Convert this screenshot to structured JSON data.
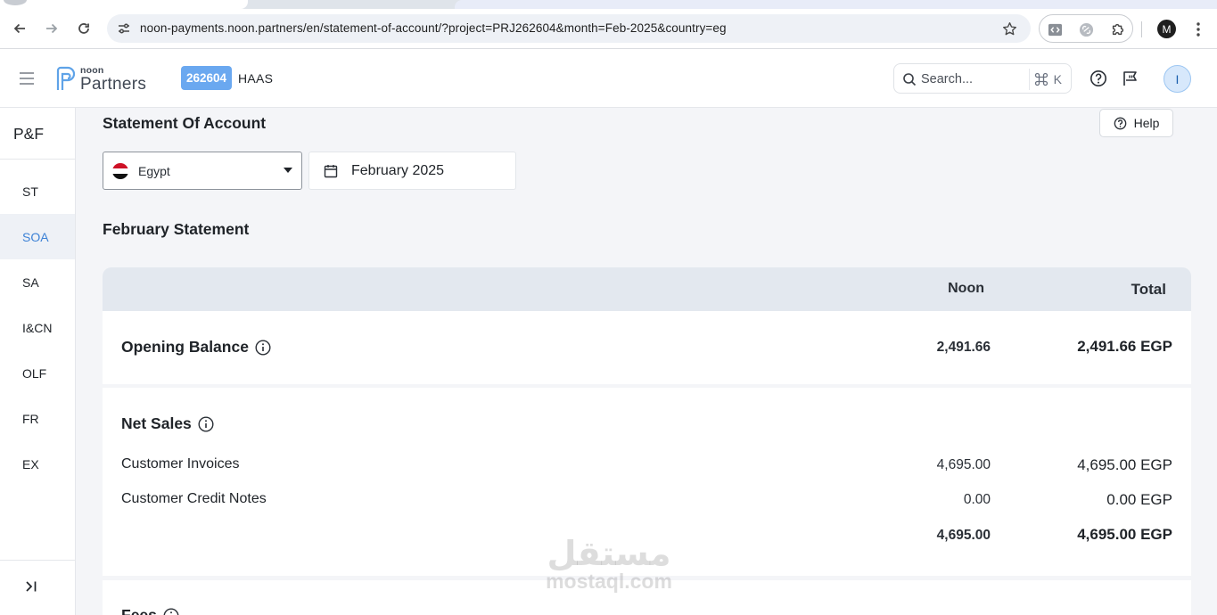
{
  "browser": {
    "url": "noon-payments.noon.partners/en/statement-of-account/?project=PRJ262604&month=Feb-2025&country=eg",
    "profile_initial": "M"
  },
  "header": {
    "logo_small": "noon",
    "logo_big": "Partners",
    "project_id": "262604",
    "project_name": "HAAS",
    "search_placeholder": "Search...",
    "search_shortcut_key": "K",
    "user_initial": "I"
  },
  "sidebar": {
    "title": "P&F",
    "items": [
      {
        "label": "ST",
        "active": false
      },
      {
        "label": "SOA",
        "active": true
      },
      {
        "label": "SA",
        "active": false
      },
      {
        "label": "I&CN",
        "active": false
      },
      {
        "label": "OLF",
        "active": false
      },
      {
        "label": "FR",
        "active": false
      },
      {
        "label": "EX",
        "active": false
      }
    ]
  },
  "main": {
    "page_title": "Statement Of Account",
    "help_label": "Help",
    "country": "Egypt",
    "month": "February 2025",
    "section_title": "February Statement",
    "columns": {
      "noon": "Noon",
      "total": "Total"
    },
    "opening_balance": {
      "label": "Opening Balance",
      "noon": "2,491.66",
      "total": "2,491.66 EGP"
    },
    "net_sales": {
      "label": "Net Sales",
      "rows": [
        {
          "label": "Customer Invoices",
          "noon": "4,695.00",
          "total": "4,695.00 EGP"
        },
        {
          "label": "Customer Credit Notes",
          "noon": "0.00",
          "total": "0.00 EGP"
        }
      ],
      "subtotal_noon": "4,695.00",
      "subtotal_total": "4,695.00 EGP"
    },
    "fees": {
      "label": "Fees"
    }
  },
  "watermark": {
    "arabic": "مستقل",
    "latin": "mostaql.com"
  },
  "colors": {
    "accent": "#3d82d6",
    "badge": "#6aa8f0",
    "table_header": "#e3e8ef",
    "page_background": "#f4f5f8"
  }
}
